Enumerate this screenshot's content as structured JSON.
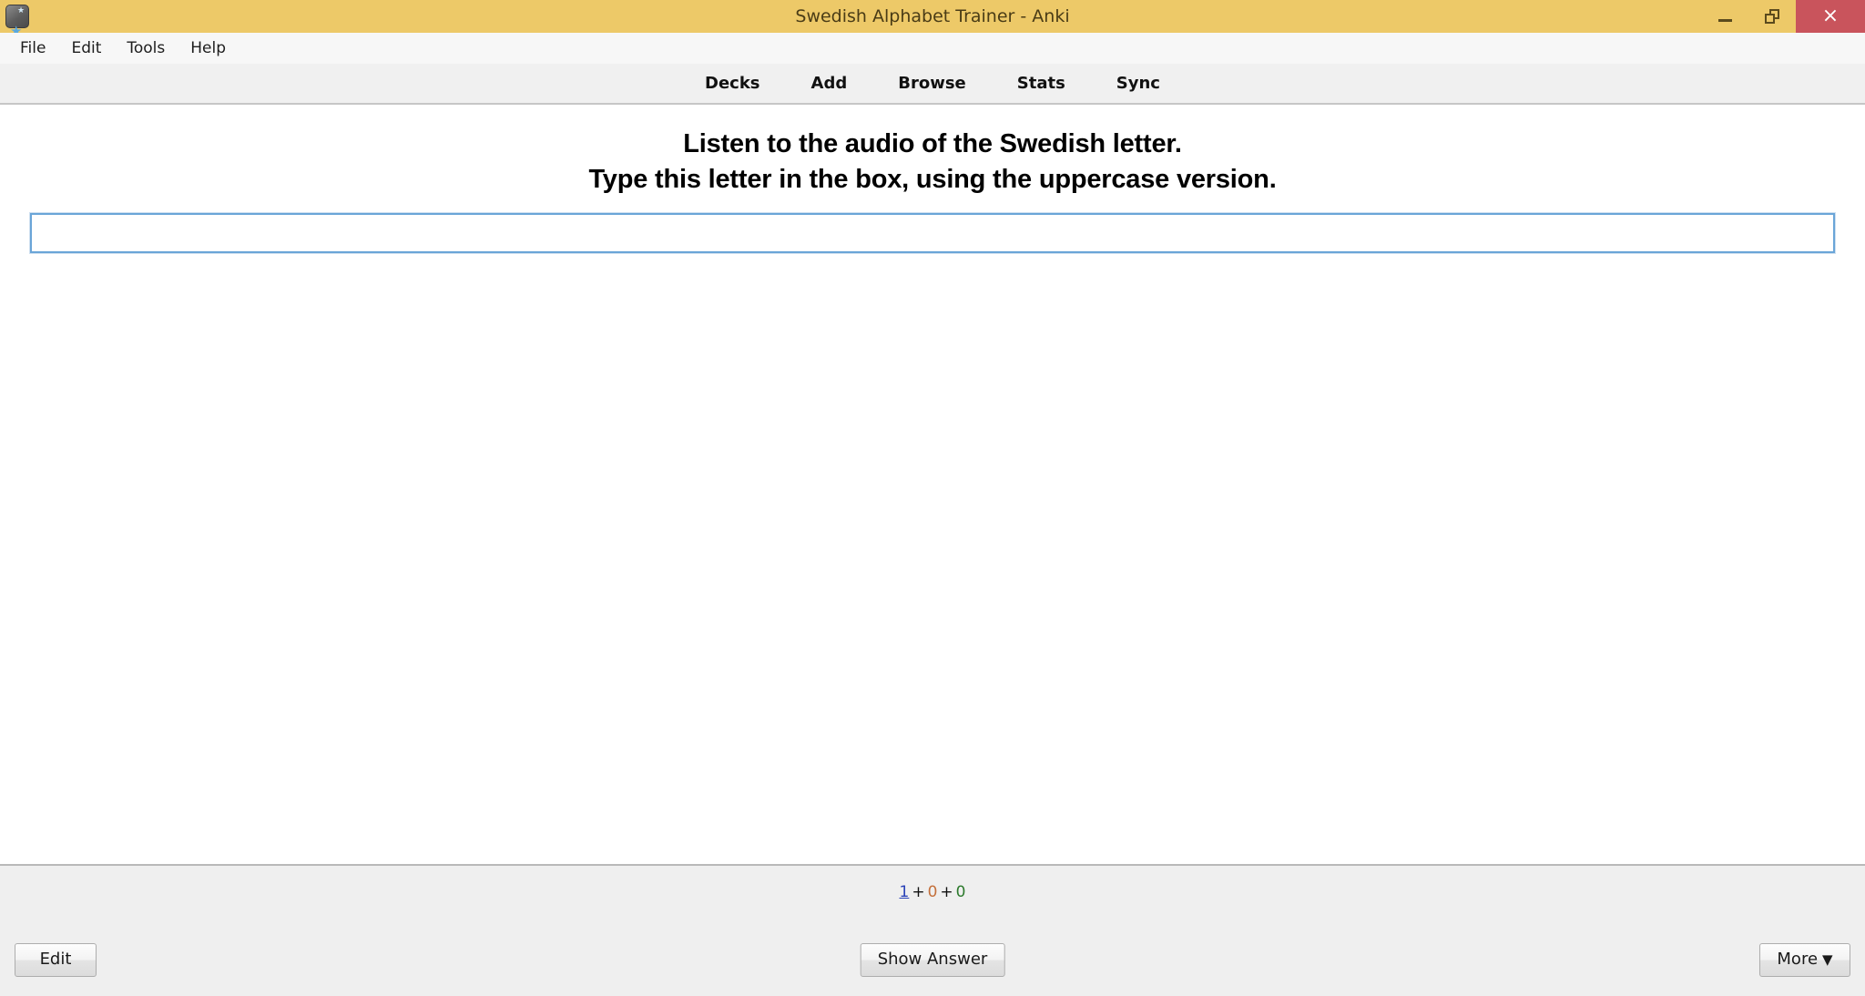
{
  "window": {
    "title": "Swedish Alphabet Trainer - Anki",
    "icon": "anki-star-icon",
    "titlebar_color": "#edc968",
    "close_button_color": "#c9545c",
    "controls": {
      "minimize": "minimize",
      "maximize": "restore",
      "close": "×"
    }
  },
  "menubar": {
    "items": [
      {
        "label": "File"
      },
      {
        "label": "Edit"
      },
      {
        "label": "Tools"
      },
      {
        "label": "Help"
      }
    ]
  },
  "navbar": {
    "items": [
      {
        "label": "Decks"
      },
      {
        "label": "Add"
      },
      {
        "label": "Browse"
      },
      {
        "label": "Stats"
      },
      {
        "label": "Sync"
      }
    ]
  },
  "card": {
    "question_line_1": "Listen to the audio of the Swedish letter.",
    "question_line_2": "Type this letter in the box, using the uppercase version.",
    "answer_input": {
      "value": "",
      "placeholder": ""
    }
  },
  "bottombar": {
    "counts": {
      "new": "1",
      "plus_1": "+",
      "learning": "0",
      "plus_2": "+",
      "review": "0",
      "new_color": "#2a42b8",
      "learning_color": "#c4703c",
      "review_color": "#2d7a2d"
    },
    "edit_label": "Edit",
    "show_answer_label": "Show Answer",
    "more_label": "More",
    "more_caret": "▼"
  }
}
